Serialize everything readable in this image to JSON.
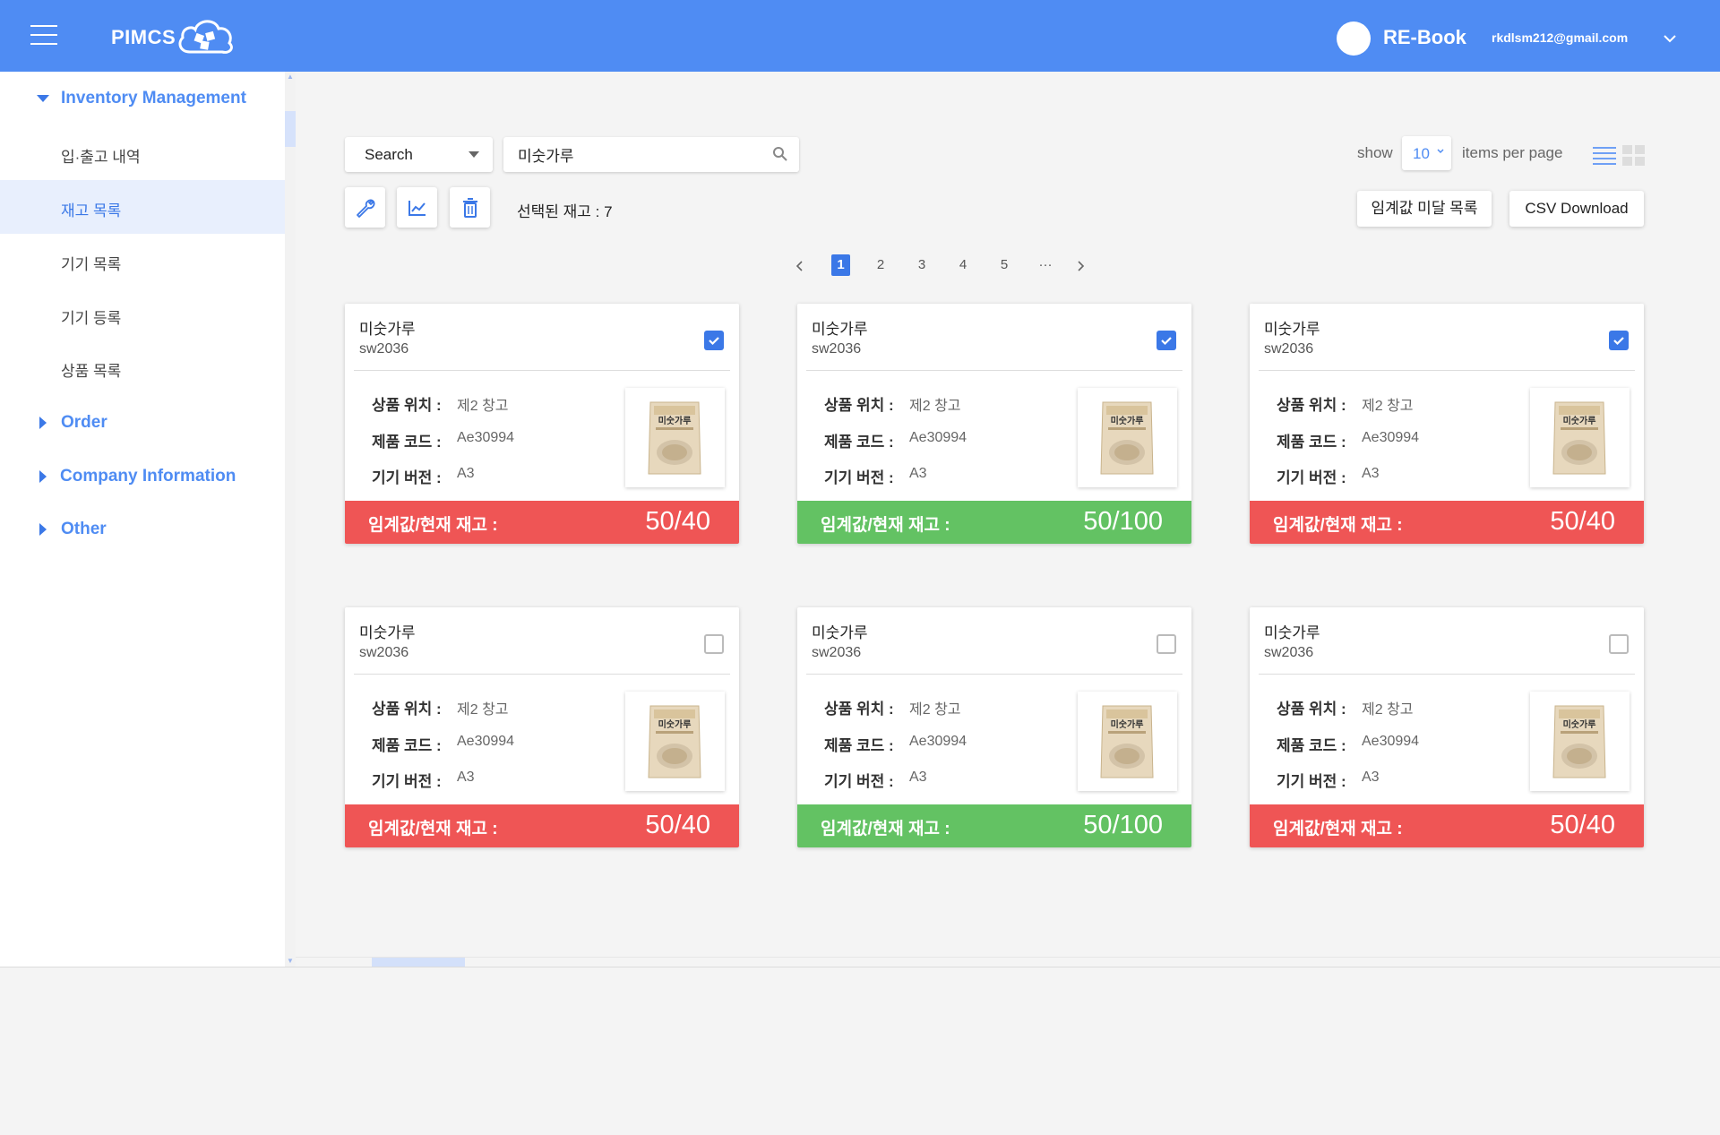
{
  "header": {
    "brand": "PIMCS",
    "org_name": "RE-Book",
    "user_email": "rkdlsm212@gmail.com"
  },
  "sidebar": {
    "groups": [
      {
        "label": "Inventory Management",
        "expanded": true,
        "items": [
          {
            "label": "입·출고 내역",
            "active": false
          },
          {
            "label": "재고 목록",
            "active": true
          },
          {
            "label": "기기 목록",
            "active": false
          },
          {
            "label": "기기 등록",
            "active": false
          },
          {
            "label": "상품 목록",
            "active": false
          }
        ]
      },
      {
        "label": "Order",
        "expanded": false
      },
      {
        "label": "Company Information",
        "expanded": false
      },
      {
        "label": "Other",
        "expanded": false
      }
    ]
  },
  "toolbar": {
    "search_type": "Search",
    "search_value": "미숫가루",
    "selected_count_text": "선택된 재고 : 7",
    "show_label": "show",
    "per_page": "10",
    "items_label": "items per page",
    "threshold_button": "임계값 미달 목록",
    "csv_button": "CSV Download"
  },
  "pagination": {
    "pages": [
      "1",
      "2",
      "3",
      "4",
      "5",
      "···"
    ],
    "current": "1"
  },
  "card_labels": {
    "location": "상품 위치 :",
    "code": "제품 코드 :",
    "version": "기기 버전 :",
    "stock": "임계값/현재 재고 :"
  },
  "cards": [
    {
      "name": "미숫가루",
      "id": "sw2036",
      "location": "제2 창고",
      "code": "Ae30994",
      "version": "A3",
      "stock": "50/40",
      "status": "below",
      "checked": true
    },
    {
      "name": "미숫가루",
      "id": "sw2036",
      "location": "제2 창고",
      "code": "Ae30994",
      "version": "A3",
      "stock": "50/100",
      "status": "ok",
      "checked": true
    },
    {
      "name": "미숫가루",
      "id": "sw2036",
      "location": "제2 창고",
      "code": "Ae30994",
      "version": "A3",
      "stock": "50/40",
      "status": "below",
      "checked": true
    },
    {
      "name": "미숫가루",
      "id": "sw2036",
      "location": "제2 창고",
      "code": "Ae30994",
      "version": "A3",
      "stock": "50/40",
      "status": "below",
      "checked": false
    },
    {
      "name": "미숫가루",
      "id": "sw2036",
      "location": "제2 창고",
      "code": "Ae30994",
      "version": "A3",
      "stock": "50/100",
      "status": "ok",
      "checked": false
    },
    {
      "name": "미숫가루",
      "id": "sw2036",
      "location": "제2 창고",
      "code": "Ae30994",
      "version": "A3",
      "stock": "50/40",
      "status": "below",
      "checked": false
    }
  ],
  "product_image_text": "미숫가루",
  "colors": {
    "header": "#4f8cf3",
    "accent": "#3b78e7",
    "stock_below": "#ef5555",
    "stock_ok": "#63c263"
  },
  "icons": [
    "hamburger-icon",
    "cloud-logo-icon",
    "chevron-down-icon",
    "search-icon",
    "wrench-icon",
    "chart-icon",
    "trash-icon",
    "list-view-icon",
    "grid-view-icon",
    "check-icon",
    "caret-icon",
    "chevron-left-icon",
    "chevron-right-icon"
  ]
}
